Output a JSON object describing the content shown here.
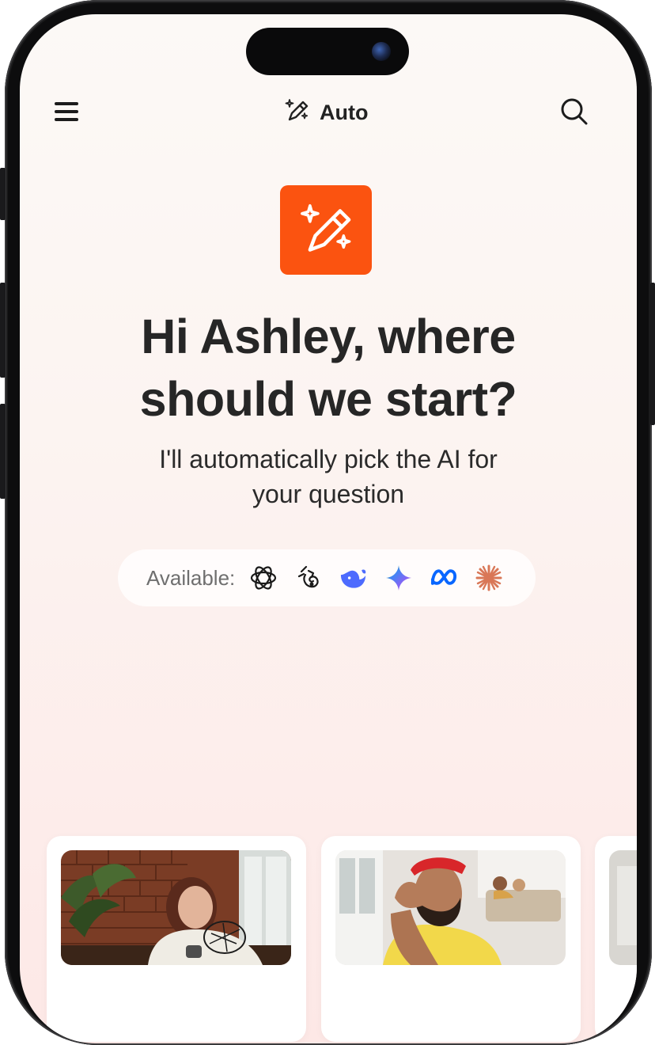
{
  "header": {
    "mode_label": "Auto",
    "mode_icon": "magic-pencil-icon",
    "menu_icon": "hamburger-menu-icon",
    "search_icon": "search-icon"
  },
  "hero": {
    "logo_icon": "magic-pencil-icon",
    "brand_color": "#fb5310",
    "title_line1": "Hi Ashley, where",
    "title_line2": "should we start?",
    "subtitle_line1": "I'll automatically pick the AI for",
    "subtitle_line2": "your question"
  },
  "available": {
    "label": "Available:",
    "models": [
      {
        "icon": "openai-knot-icon",
        "color": "#1a1a1a"
      },
      {
        "icon": "grok-logo-icon",
        "color": "#1a1a1a"
      },
      {
        "icon": "deepseek-whale-icon",
        "color": "#4d6bfe"
      },
      {
        "icon": "gemini-sparkle-icon",
        "color": "#4285f4"
      },
      {
        "icon": "meta-infinity-icon",
        "color": "#0866ff"
      },
      {
        "icon": "claude-starburst-icon",
        "color": "#d97757"
      }
    ]
  },
  "suggestions": [
    {
      "image": "woman-with-mug-photo"
    },
    {
      "image": "laughing-man-photo"
    },
    {
      "image": "interior-photo"
    }
  ]
}
